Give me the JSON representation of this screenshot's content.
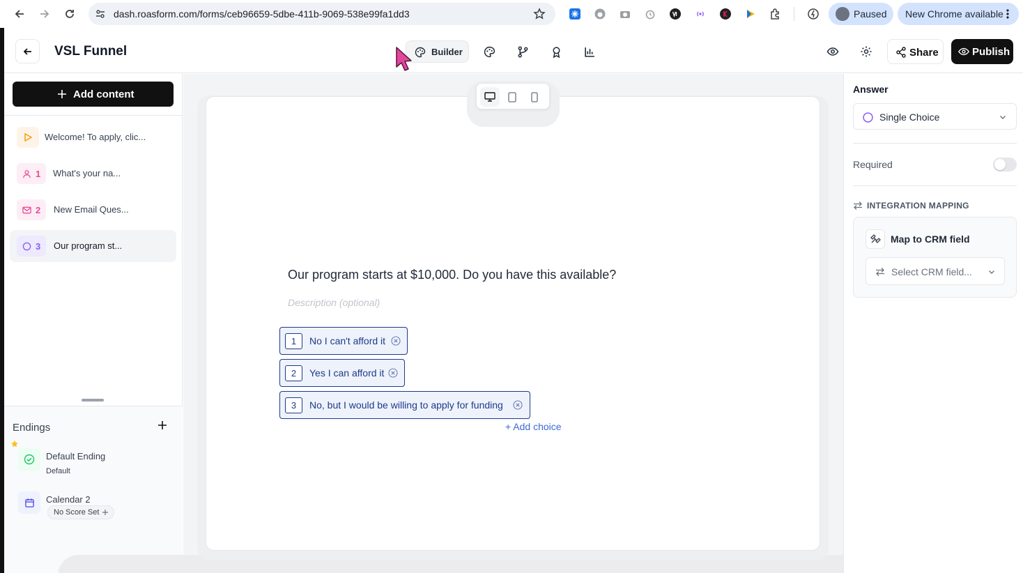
{
  "browser": {
    "url": "dash.roasform.com/forms/ceb96659-5dbe-411b-9069-538e99fa1dd3",
    "profile_status": "Paused",
    "update_label": "New Chrome available"
  },
  "header": {
    "title": "VSL Funnel",
    "builder_tab": "Builder",
    "share_label": "Share",
    "publish_label": "Publish"
  },
  "sidebar": {
    "add_content_label": "Add content",
    "questions": [
      {
        "number": "",
        "label": "Welcome! To apply, clic...",
        "icon": "play-icon",
        "color": "#f59e0b"
      },
      {
        "number": "1",
        "label": "What's your na...",
        "icon": "user-icon",
        "color": "#ec4899"
      },
      {
        "number": "2",
        "label": "New Email Ques...",
        "icon": "mail-icon",
        "color": "#ec4899"
      },
      {
        "number": "3",
        "label": "Our program st...",
        "icon": "circle-icon",
        "color": "#8b5cf6"
      }
    ],
    "endings_title": "Endings",
    "endings": [
      {
        "title": "Default Ending",
        "subtitle": "Default",
        "icon": "check-circle-icon"
      },
      {
        "title": "Calendar 2",
        "subtitle": "No Score Set",
        "icon": "calendar-icon"
      }
    ]
  },
  "canvas": {
    "question": "Our program starts at $10,000. Do you have this available?",
    "description_placeholder": "Description (optional)",
    "choices": [
      {
        "key": "1",
        "text": "No I can't afford it"
      },
      {
        "key": "2",
        "text": "Yes I can afford it"
      },
      {
        "key": "3",
        "text": "No, but I would be willing to apply for funding"
      }
    ],
    "add_choice_label": "+ Add choice"
  },
  "right_panel": {
    "answer_label": "Answer",
    "answer_type": "Single Choice",
    "required_label": "Required",
    "required": false,
    "integration_label": "INTEGRATION MAPPING",
    "crm_title": "Map to CRM field",
    "crm_placeholder": "Select CRM field..."
  },
  "colors": {
    "choice_border": "#1e3a8a",
    "primary_button": "#111111",
    "link": "#3b6bd1"
  }
}
